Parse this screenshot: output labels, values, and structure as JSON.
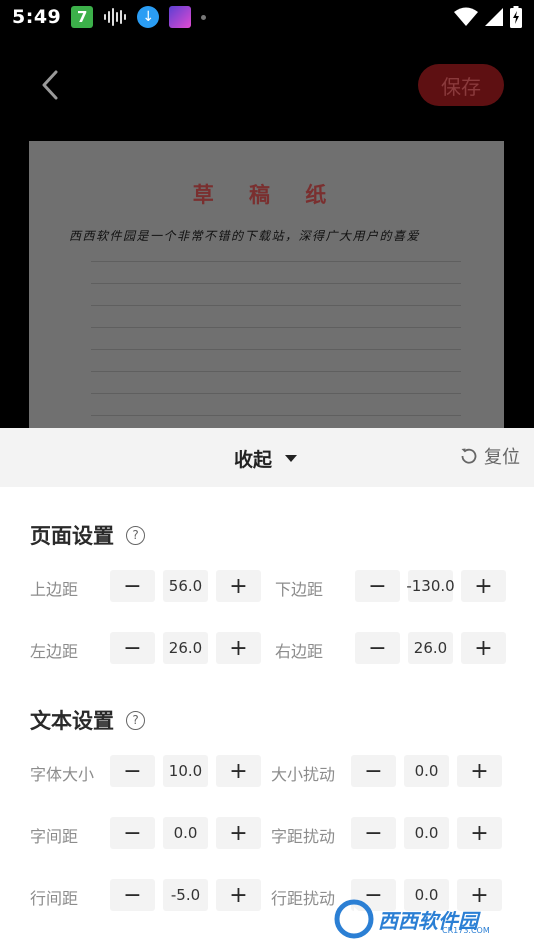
{
  "status": {
    "time": "5:49",
    "app_badge": "7"
  },
  "toolbar": {
    "save_label": "保存"
  },
  "preview": {
    "title": "草 稿 纸",
    "text": "西西软件园是一个非常不错的下载站，深得广大用户的喜爱"
  },
  "panel": {
    "collapse_label": "收起",
    "reset_label": "复位"
  },
  "page_settings": {
    "title": "页面设置",
    "help": "?",
    "fields": [
      {
        "label": "上边距",
        "value": "56.0"
      },
      {
        "label": "下边距",
        "value": "-130.0"
      },
      {
        "label": "左边距",
        "value": "26.0"
      },
      {
        "label": "右边距",
        "value": "26.0"
      }
    ]
  },
  "text_settings": {
    "title": "文本设置",
    "help": "?",
    "fields": [
      {
        "label": "字体大小",
        "value": "10.0"
      },
      {
        "label": "大小扰动",
        "value": "0.0"
      },
      {
        "label": "字间距",
        "value": "0.0"
      },
      {
        "label": "字距扰动",
        "value": "0.0"
      },
      {
        "label": "行间距",
        "value": "-5.0"
      },
      {
        "label": "行距扰动",
        "value": "0.0"
      }
    ]
  },
  "stepper": {
    "minus": "−",
    "plus": "+"
  },
  "watermark": {
    "text": "西西软件园",
    "sub": "CR173.COM"
  }
}
